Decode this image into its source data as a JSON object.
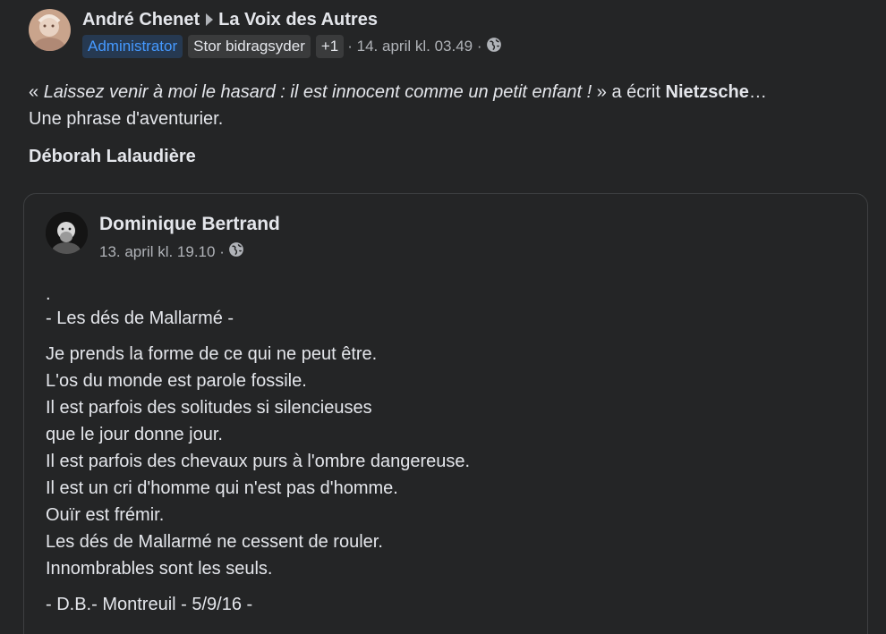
{
  "post": {
    "author": "André Chenet",
    "group": "La Voix des Autres",
    "badges": [
      "Administrator",
      "Stor bidragsyder",
      "+1"
    ],
    "timestamp": "· 14. april kl. 03.49 ·",
    "quote_open": "« ",
    "quote_italic": "Laissez venir à moi le hasard : il est innocent comme un petit enfant !",
    "quote_close": " » a écrit ",
    "quote_author": "Nietzsche",
    "quote_ellipsis": "…",
    "line2": "Une phrase d'aventurier.",
    "signature": "Déborah Lalaudière"
  },
  "shared": {
    "author": "Dominique Bertrand",
    "timestamp": "13. april kl. 19.10 ·",
    "dot": ".",
    "subtitle": "- Les dés de Mallarmé -",
    "lines": [
      "Je prends la forme de ce qui ne peut être.",
      "L'os du monde est parole fossile.",
      "Il est parfois des solitudes si silencieuses",
      "que le jour donne jour.",
      "Il est parfois des chevaux purs à l'ombre dangereuse.",
      "Il est un cri d'homme qui n'est pas d'homme.",
      "Ouïr est frémir.",
      "Les dés de Mallarmé ne cessent de rouler.",
      "Innombrables sont les seuls."
    ],
    "signoff": "- D.B.- Montreuil - 5/9/16 -"
  },
  "icons": {
    "privacy": "globe-icon",
    "separator": "caret-right-icon"
  },
  "colors": {
    "background": "#242526",
    "text": "#e4e6eb",
    "secondary": "#b0b3b8",
    "admin_badge_bg": "#263951",
    "admin_badge_text": "#4599ff",
    "badge_bg": "#3a3b3c"
  }
}
